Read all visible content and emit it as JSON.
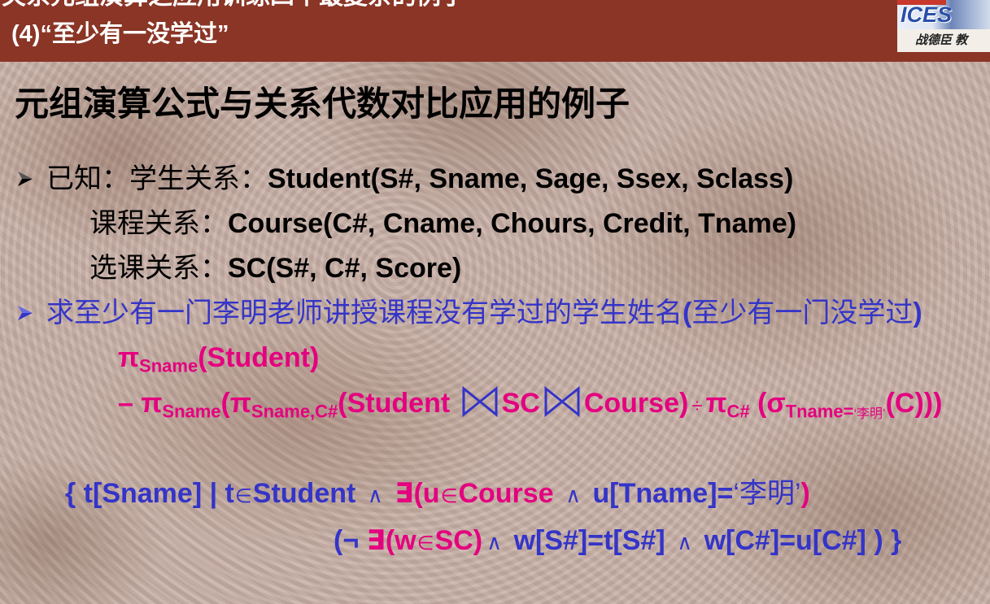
{
  "header": {
    "top_line": "关系元组演算之应用训练四个最复杂的例子",
    "subtitle": "(4)“至少有一没学过”",
    "logo": {
      "text": "ICES",
      "caption": "战德臣 教"
    }
  },
  "slide": {
    "title": "元组演算公式与关系代数对比应用的例子",
    "known": {
      "bullet_icon": "arrowhead-bullet-icon",
      "lead": "已知：",
      "relations": [
        {
          "label": "学生关系：",
          "schema": "Student(S#, Sname, Sage, Ssex, Sclass)"
        },
        {
          "label": "课程关系：",
          "schema": "Course(C#, Cname, Chours, Credit, Tname)"
        },
        {
          "label": "选课关系：",
          "schema": "SC(S#, C#, Score)"
        }
      ]
    },
    "question": {
      "bullet_icon": "arrowhead-bullet-icon",
      "text": "求至少有一门李明老师讲授课程没有学过的学生姓名",
      "note_open": "(",
      "note": "至少有一门没学过",
      "note_close": ")"
    },
    "relational_algebra": {
      "join_icon": "natural-join-icon",
      "line1": [
        "π",
        "Sname",
        "(Student)"
      ],
      "line2": [
        "– π",
        "Sname",
        "(π",
        "Sname,C#",
        "(Student ",
        "SC",
        "Course)",
        "÷",
        "π",
        "C#",
        " (σ",
        "Tname=",
        "‘李明’",
        "(C)))"
      ]
    },
    "tuple_calculus": {
      "line1": [
        "{ t[Sname] | t",
        "∈",
        "Student ",
        "∧",
        " ∃(u",
        "∈",
        "Course ",
        "∧",
        " u[Tname]=",
        "‘李明’",
        ")"
      ],
      "line2": [
        "(¬ ",
        "∃(w",
        "∈",
        "SC)",
        "∧",
        " w[S#]=t[S#] ",
        "∧",
        " w[C#]=u[C#] ) }"
      ]
    }
  },
  "colors": {
    "header": "#8a3526",
    "header_text": "#ffffff",
    "text": "#000000",
    "blue": "#3434c8",
    "magenta": "#e4007f"
  }
}
